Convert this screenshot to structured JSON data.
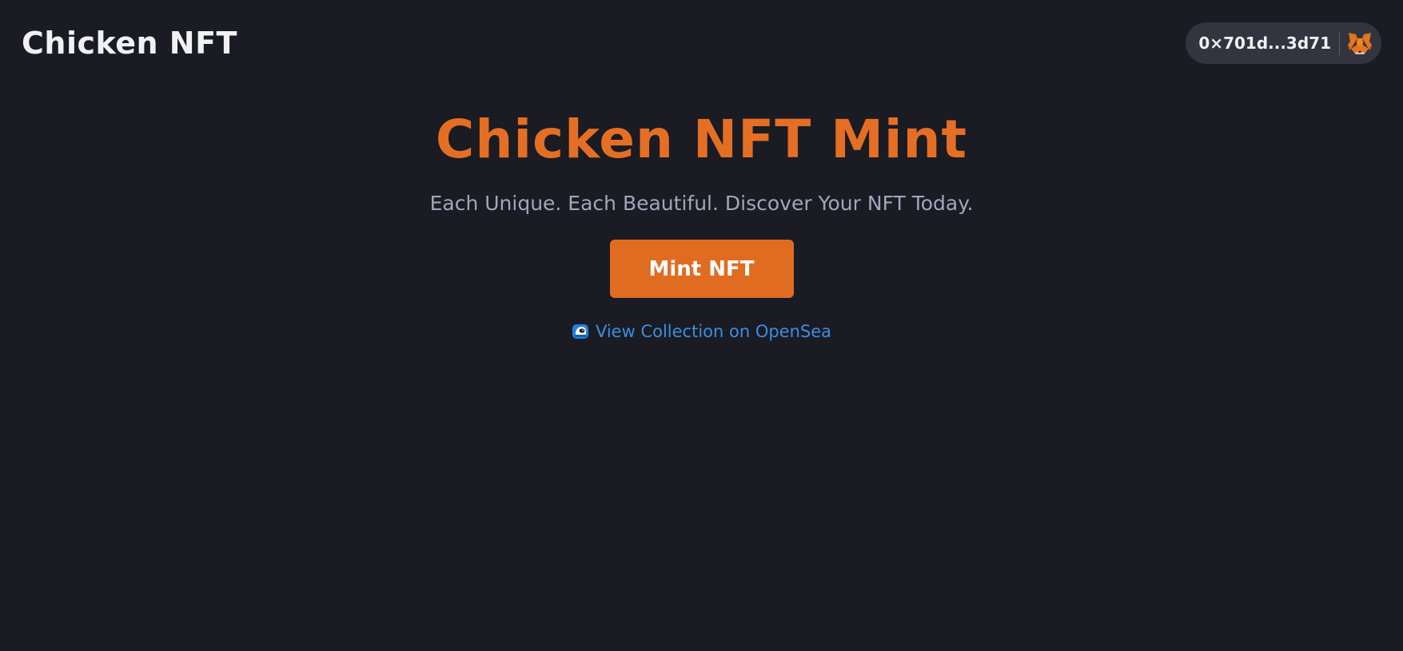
{
  "header": {
    "brand": "Chicken NFT",
    "wallet": {
      "address": "0×701d...3d71",
      "icon": "metamask-fox-icon"
    }
  },
  "hero": {
    "title": "Chicken NFT Mint",
    "subtitle": "Each Unique. Each Beautiful. Discover Your NFT Today.",
    "mint_button_label": "Mint NFT",
    "opensea_link": {
      "icon": "opensea-logo-icon",
      "label": "View Collection on OpenSea"
    }
  },
  "colors": {
    "background": "#1a1b23",
    "accent": "#e06c22",
    "link": "#3a8fe0",
    "subtitle": "#a2a6bc",
    "wallet_pill": "#343441"
  }
}
